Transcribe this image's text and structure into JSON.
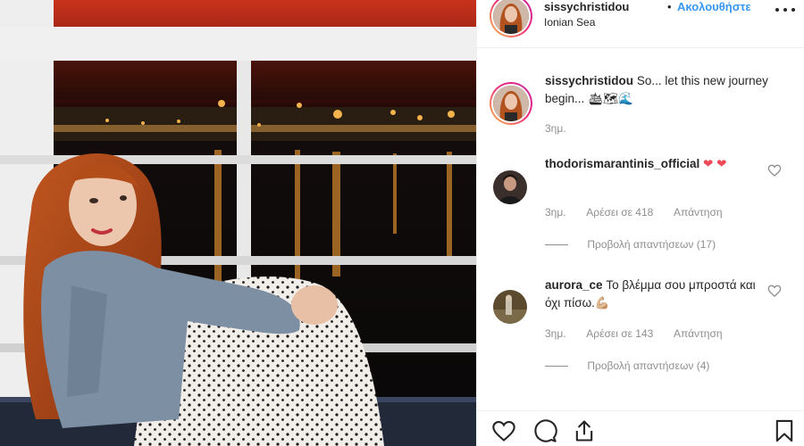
{
  "post": {
    "username": "sissychristidou",
    "separator": "•",
    "follow_label": "Ακολουθήστε",
    "location": "Ionian Sea"
  },
  "caption": {
    "username": "sissychristidou",
    "text": "So... let this new journey begin... 🛳🗺🌊",
    "time": "3ημ."
  },
  "comments": [
    {
      "username": "thodorismarantinis_official",
      "text": "❤ ❤",
      "time": "3ημ.",
      "likes": "Αρέσει σε 418",
      "reply_label": "Απάντηση",
      "view_replies": "Προβολή απαντήσεων (17)"
    },
    {
      "username": "aurora_ce",
      "text": "Το βλέμμα σου μπροστά και όχι πίσω.💪🏼",
      "time": "3ημ.",
      "likes": "Αρέσει σε 143",
      "reply_label": "Απάντηση",
      "view_replies": "Προβολή απαντήσεων (4)"
    }
  ],
  "icons": {
    "more": "more-dots-icon",
    "like": "heart-outline-icon",
    "comment": "comment-bubble-icon",
    "share": "share-upload-icon",
    "save": "bookmark-icon"
  },
  "colors": {
    "link": "#3897f0",
    "secondary_text": "#8e8e8e",
    "heart": "#ed4956",
    "border": "#efefef"
  }
}
